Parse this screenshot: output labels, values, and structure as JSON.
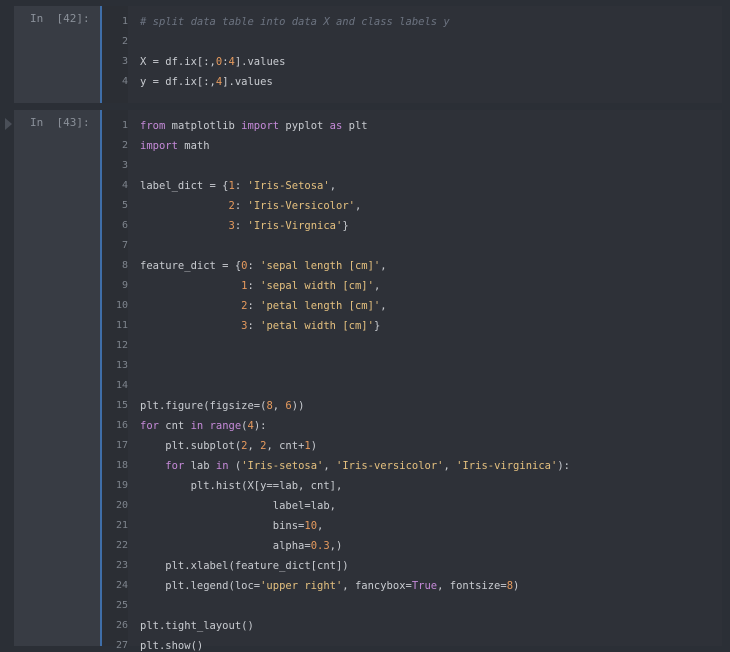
{
  "cells": [
    {
      "prompt": "In  [42]:",
      "lines": [
        "# split data table into data X and class labels y",
        "",
        "X = df.ix[:,0:4].values",
        "y = df.ix[:,4].values"
      ]
    },
    {
      "prompt": "In  [43]:",
      "lines": [
        "from matplotlib import pyplot as plt",
        "import math",
        "",
        "label_dict = {1: 'Iris-Setosa',",
        "              2: 'Iris-Versicolor',",
        "              3: 'Iris-Virgnica'}",
        "",
        "feature_dict = {0: 'sepal length [cm]',",
        "                1: 'sepal width [cm]',",
        "                2: 'petal length [cm]',",
        "                3: 'petal width [cm]'}",
        "",
        "",
        "",
        "plt.figure(figsize=(8, 6))",
        "for cnt in range(4):",
        "    plt.subplot(2, 2, cnt+1)",
        "    for lab in ('Iris-setosa', 'Iris-versicolor', 'Iris-virginica'):",
        "        plt.hist(X[y==lab, cnt],",
        "                     label=lab,",
        "                     bins=10,",
        "                     alpha=0.3,)",
        "    plt.xlabel(feature_dict[cnt])",
        "    plt.legend(loc='upper right', fancybox=True, fontsize=8)",
        "",
        "plt.tight_layout()",
        "plt.show()"
      ]
    }
  ],
  "icons": {
    "run_marker": "run-triangle-icon"
  },
  "colors": {
    "keyword": "#c58ad8",
    "string": "#e4c07f",
    "number": "#e59a5e",
    "comment": "#6c7380",
    "selection_bar": "#3f6ea8"
  }
}
